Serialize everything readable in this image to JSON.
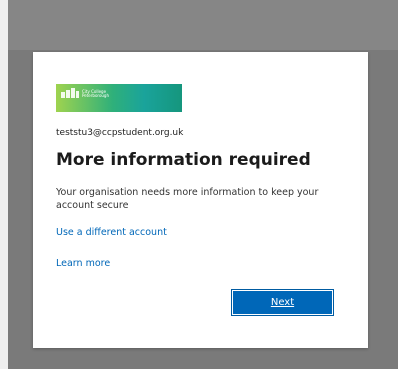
{
  "logo": {
    "text_line1": "City College",
    "text_line2": "Peterborough",
    "colors": [
      "#9fd34f",
      "#2fb07a",
      "#15967d"
    ]
  },
  "account": {
    "username": "teststu3@ccpstudent.org.uk"
  },
  "main": {
    "title": "More information required",
    "description": "Your organisation needs more information to keep your account secure"
  },
  "links": {
    "different_account": "Use a different account",
    "learn_more": "Learn more"
  },
  "actions": {
    "next_label": "Next"
  },
  "colors": {
    "accent": "#0067b8",
    "backdrop": "#7a7a7a",
    "card": "#ffffff"
  }
}
